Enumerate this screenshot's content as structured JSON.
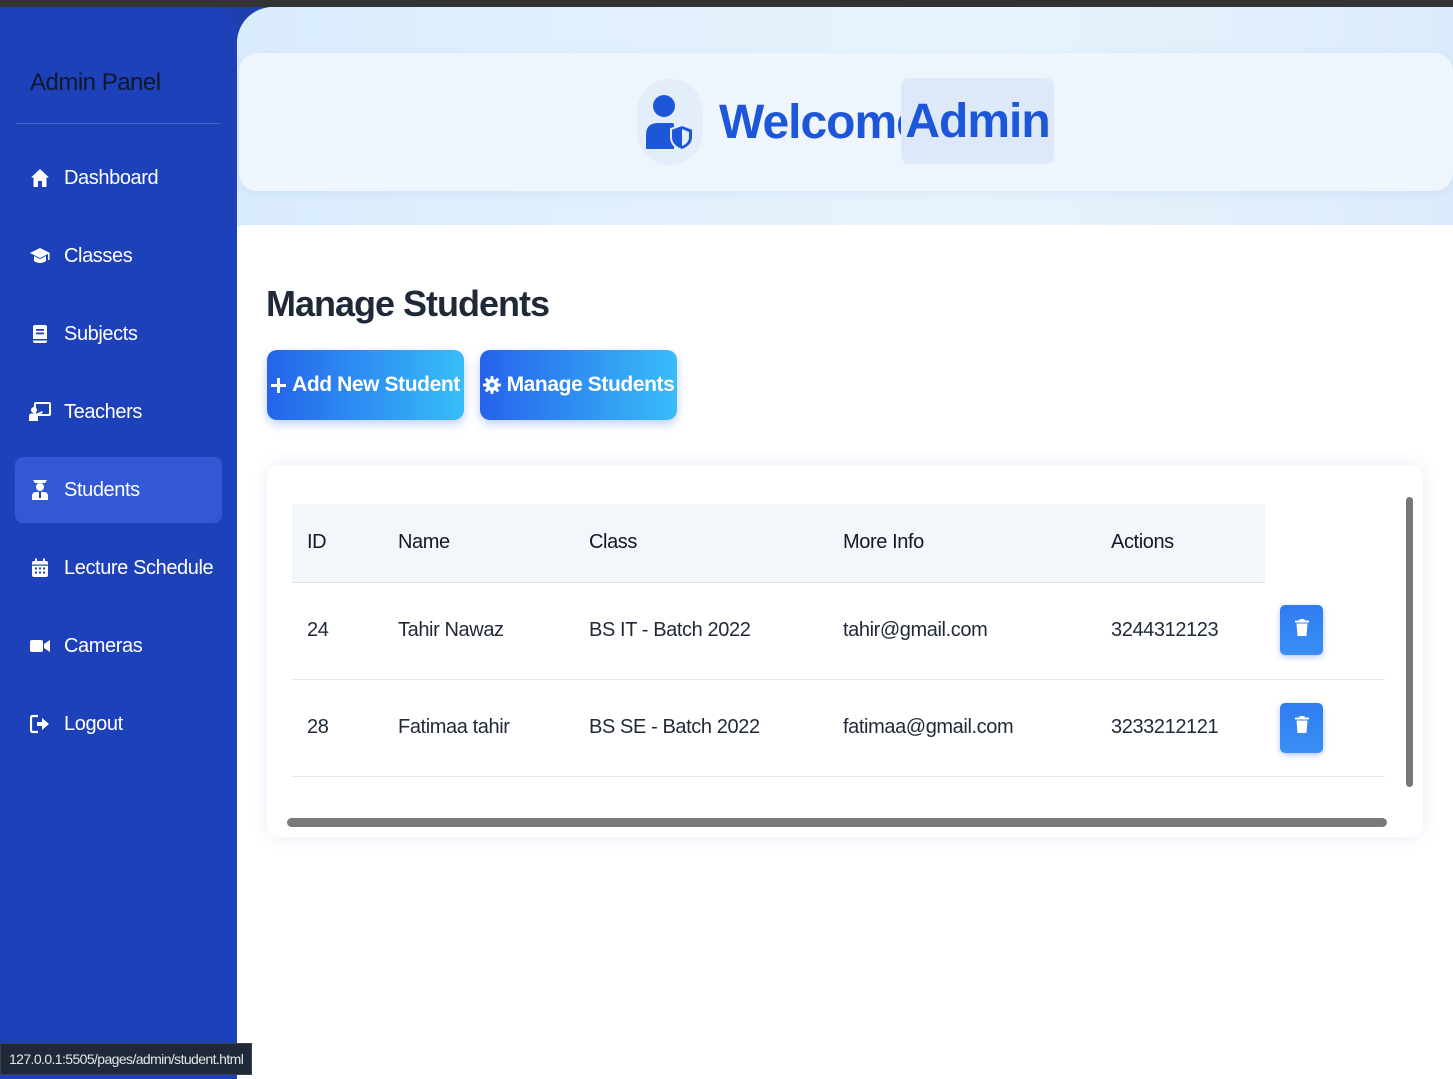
{
  "sidebar": {
    "title": "Admin Panel",
    "items": [
      {
        "label": "Dashboard",
        "icon": "home-icon"
      },
      {
        "label": "Classes",
        "icon": "graduation-cap-icon"
      },
      {
        "label": "Subjects",
        "icon": "book-icon"
      },
      {
        "label": "Teachers",
        "icon": "chalkboard-teacher-icon"
      },
      {
        "label": "Students",
        "icon": "user-graduate-icon",
        "active": true
      },
      {
        "label": "Lecture Schedule",
        "icon": "calendar-icon"
      },
      {
        "label": "Cameras",
        "icon": "video-camera-icon"
      },
      {
        "label": "Logout",
        "icon": "sign-out-icon"
      }
    ]
  },
  "header": {
    "welcome": "Welcome,",
    "user": "Admin",
    "icon": "user-shield-icon"
  },
  "main": {
    "title": "Manage Students",
    "add_button": "Add New Student",
    "manage_button": "Manage Students"
  },
  "table": {
    "headers": [
      "ID",
      "Name",
      "Class",
      "More Info",
      "Actions"
    ],
    "rows": [
      {
        "id": "24",
        "name": "Tahir Nawaz",
        "class": "BS IT - Batch 2022",
        "info": "tahir@gmail.com",
        "actions": "3244312123"
      },
      {
        "id": "28",
        "name": "Fatimaa tahir",
        "class": "BS SE - Batch 2022",
        "info": "fatimaa@gmail.com",
        "actions": "3233212121"
      }
    ]
  },
  "status_bar": {
    "url": "127.0.0.1:5505/pages/admin/student.html"
  },
  "colors": {
    "sidebar": "#1d41b8",
    "accent": "#2563eb",
    "accent_light": "#38bdf8",
    "heading_blue": "#1d56d8"
  }
}
